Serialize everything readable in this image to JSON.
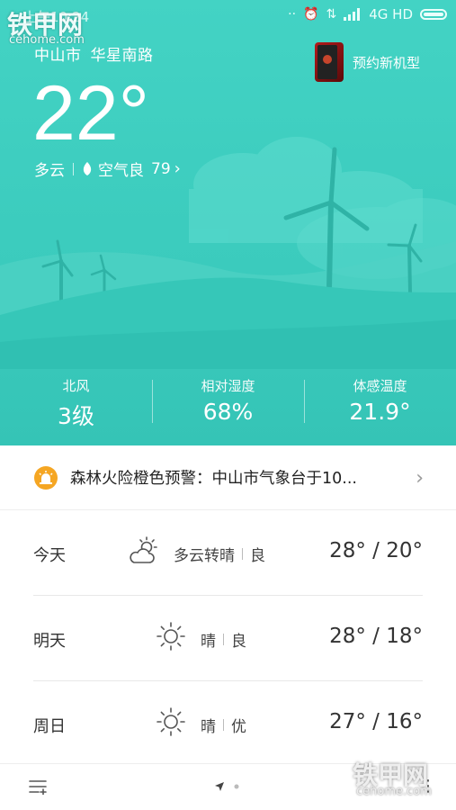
{
  "status_bar": {
    "time": "上午10:24",
    "network": "4G HD",
    "icons": [
      "alarm-icon",
      "data-arrows-icon",
      "signal-icon",
      "battery-icon"
    ]
  },
  "location": {
    "city": "中山市",
    "district": "华星南路"
  },
  "promo": {
    "label": "预约新机型",
    "icon": "phone-icon"
  },
  "current": {
    "temperature": "22°",
    "condition": "多云",
    "aqi_label": "空气良",
    "aqi_value": "79",
    "aqi_chevron": "›"
  },
  "metrics": [
    {
      "label": "北风",
      "value": "3级"
    },
    {
      "label": "相对湿度",
      "value": "68%"
    },
    {
      "label": "体感温度",
      "value": "21.9°"
    }
  ],
  "alert": {
    "text": "森林火险橙色预警：中山市气象台于10...",
    "chevron": "›"
  },
  "forecast": [
    {
      "day": "今天",
      "icon": "partly-cloudy-icon",
      "condition": "多云转晴",
      "air": "良",
      "range": "28° / 20°"
    },
    {
      "day": "明天",
      "icon": "sun-icon",
      "condition": "晴",
      "air": "良",
      "range": "28° / 18°"
    },
    {
      "day": "周日",
      "icon": "sun-icon",
      "condition": "晴",
      "air": "优",
      "range": "27° / 16°"
    }
  ],
  "bottom_bar": {
    "more": "⋮"
  },
  "watermark": {
    "brand": "铁甲网",
    "site": "cehome.com"
  },
  "colors": {
    "hero": "#3ccbbd",
    "alert": "#f5a623"
  }
}
